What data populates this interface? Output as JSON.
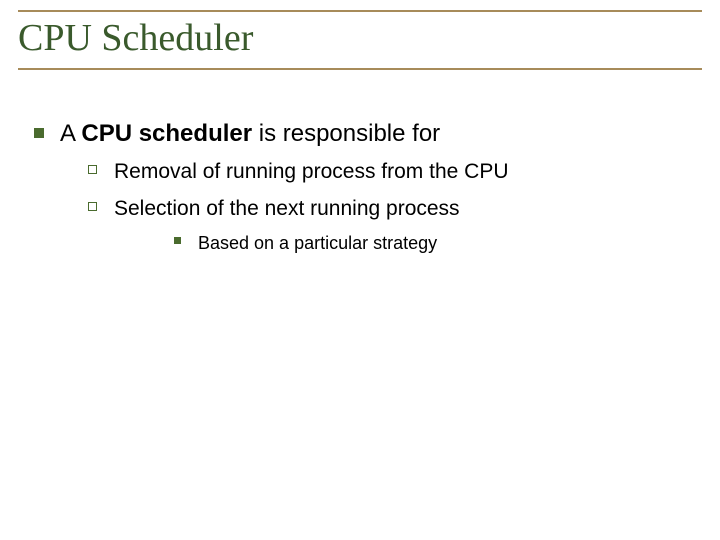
{
  "title": "CPU Scheduler",
  "level1": {
    "pre": "A ",
    "bold": "CPU scheduler",
    "post": " is responsible for"
  },
  "level2": [
    "Removal of running process from the CPU",
    "Selection of the next running process"
  ],
  "level3": "Based on a particular strategy"
}
